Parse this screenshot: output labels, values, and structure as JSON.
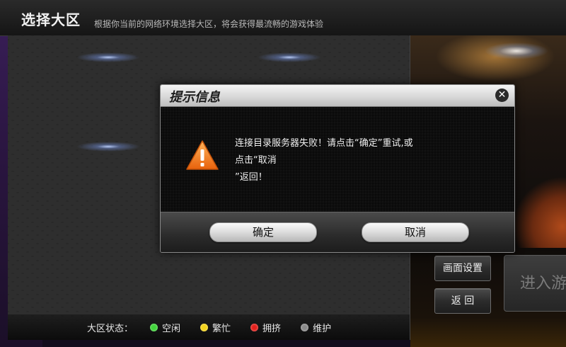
{
  "header": {
    "title": "选择大区",
    "subtitle": "根据你当前的网络环境选择大区，将会获得最流畅的游戏体验"
  },
  "legend": {
    "title": "大区状态：",
    "items": [
      {
        "label": "空闲",
        "color": "#3fd43a"
      },
      {
        "label": "繁忙",
        "color": "#f2d21a"
      },
      {
        "label": "拥挤",
        "color": "#e3201b"
      },
      {
        "label": "维护",
        "color": "#8a8a8a"
      }
    ]
  },
  "side_buttons": {
    "display_settings": "画面设置",
    "back": "返 回",
    "enter": "进入游"
  },
  "dialog": {
    "title": "提示信息",
    "close_icon": "close-icon",
    "warning_icon": "warning-icon",
    "message_line1": "连接目录服务器失败！请点击“确定”重试,或点击“取消",
    "message_line2": "”返回！",
    "confirm_label": "确定",
    "cancel_label": "取消"
  },
  "colors": {
    "warning_orange": "#f07d14",
    "dialog_bg": "#080808"
  }
}
